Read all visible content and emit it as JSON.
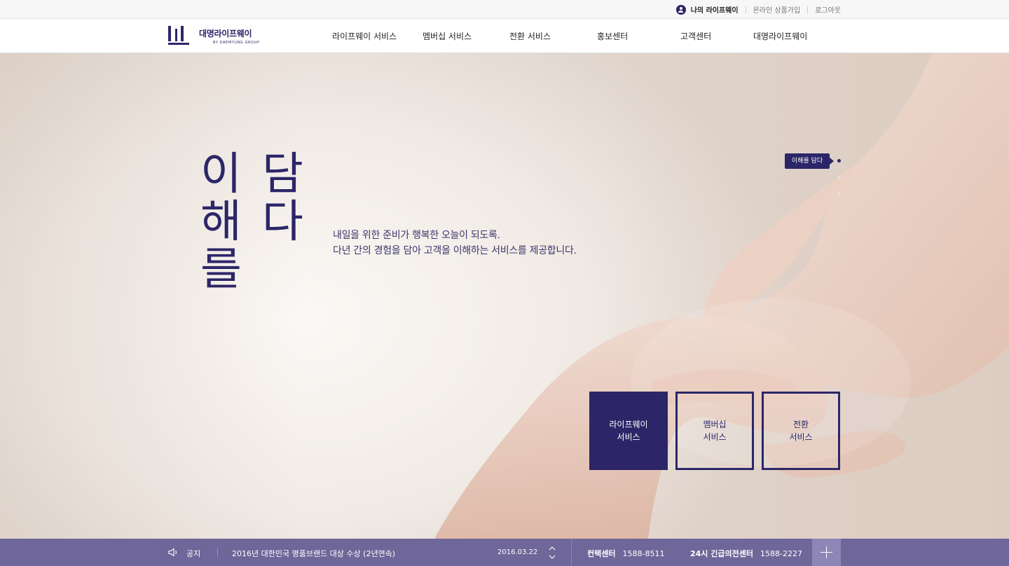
{
  "util": {
    "my_lifeway": "나의 라이프웨이",
    "online_join": "온라인 상품가입",
    "logout": "로그아웃"
  },
  "logo": {
    "ko": "대명라이프웨이",
    "en": "BY DAEMYUNG GROUP"
  },
  "gnb": {
    "items": [
      "라이프웨이 서비스",
      "멤버십 서비스",
      "전환 서비스",
      "홍보센터",
      "고객센터",
      "대명라이프웨이"
    ]
  },
  "hero": {
    "title_col1": [
      "이",
      "해",
      "를"
    ],
    "title_col2": [
      "담",
      "다"
    ],
    "copy_line1": "내일을 위한 준비가 행복한 오늘이 되도록.",
    "copy_line2": "다년 간의 경험을 담아 고객을 이해하는 서비스를 제공합니다.",
    "indicator_label": "이해를 담다",
    "slide_count": 3,
    "active_slide": 1
  },
  "services": [
    {
      "label": "라이프웨이\n서비스"
    },
    {
      "label": "멤버십\n서비스"
    },
    {
      "label": "전환\n서비스"
    }
  ],
  "bottom": {
    "notice_label": "공지",
    "notice_text": "2016년 대한민국 명품브랜드 대상 수상 (2년연속)",
    "notice_date": "2016.03.22",
    "contact_label": "컨택센터",
    "contact_number": "1588-8511",
    "emergency_label": "24시 긴급의전센터",
    "emergency_number": "1588-2227"
  },
  "colors": {
    "brand": "#2c2668",
    "bottom_bar": "#6f6699",
    "plus_button": "#8f86b8"
  }
}
